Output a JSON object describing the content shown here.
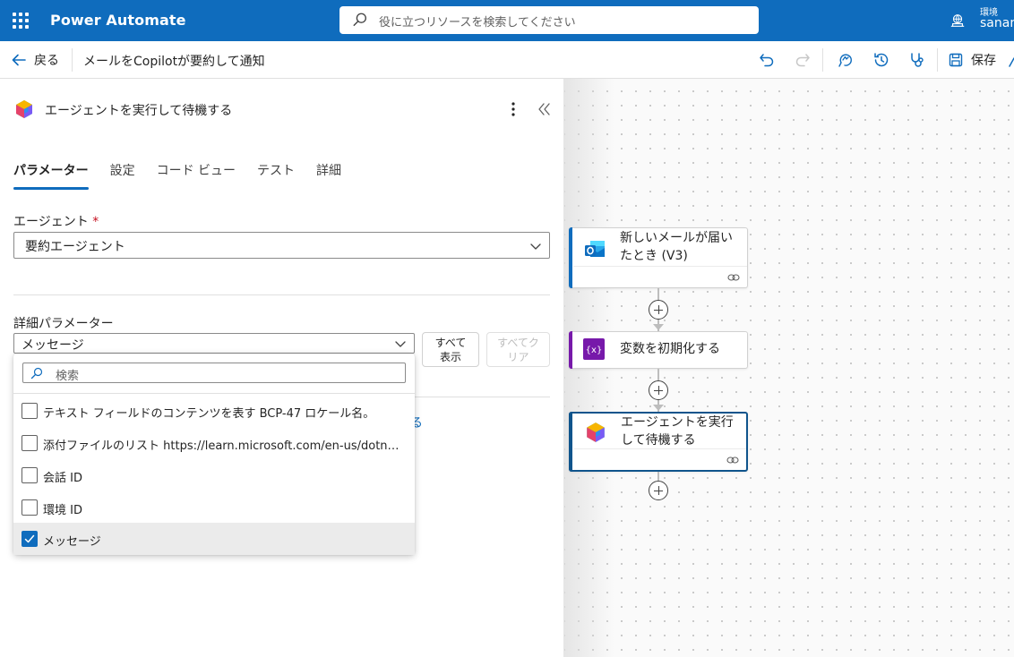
{
  "topbar": {
    "app_title": "Power Automate",
    "search_placeholder": "役に立つリソースを検索してください",
    "env_label": "環境",
    "env_name": "sanan"
  },
  "command_bar": {
    "back_label": "戻る",
    "flow_name": "メールをCopilotが要約して通知",
    "save_label": "保存"
  },
  "panel": {
    "title": "エージェントを実行して待機する",
    "tabs": [
      {
        "label": "パラメーター",
        "active": true
      },
      {
        "label": "設定",
        "active": false
      },
      {
        "label": "コード ビュー",
        "active": false
      },
      {
        "label": "テスト",
        "active": false
      },
      {
        "label": "詳細",
        "active": false
      }
    ],
    "agent_field": {
      "label": "エージェント",
      "required_mark": "*",
      "value": "要約エージェント"
    },
    "advanced": {
      "label": "詳細パラメーター",
      "selected_value": "メッセージ",
      "show_all_button": "すべて\n表示",
      "clear_all_button": "すべてク\nリア"
    },
    "background_link_fragment": "る",
    "dropdown": {
      "search_placeholder": "検索",
      "items": [
        {
          "label": "テキスト フィールドのコンテンツを表す BCP-47 ロケール名。",
          "checked": false
        },
        {
          "label": "添付ファイルのリスト https://learn.microsoft.com/en-us/dotnet/api/...",
          "checked": false
        },
        {
          "label": "会話 ID",
          "checked": false
        },
        {
          "label": "環境 ID",
          "checked": false
        },
        {
          "label": "メッセージ",
          "checked": true
        }
      ]
    }
  },
  "canvas": {
    "nodes": [
      {
        "title": "新しいメールが届いたとき (V3)",
        "accent": "#0f6cbd",
        "icon": "outlook-icon"
      },
      {
        "title": "変数を初期化する",
        "accent": "#7719aa",
        "icon": "variable-icon"
      },
      {
        "title": "エージェントを実行して待機する",
        "accent": "#0f548c",
        "icon": "copilot-icon",
        "selected": true
      }
    ]
  },
  "colors": {
    "brand": "#0f6cbd",
    "variable_purple": "#7719aa"
  }
}
